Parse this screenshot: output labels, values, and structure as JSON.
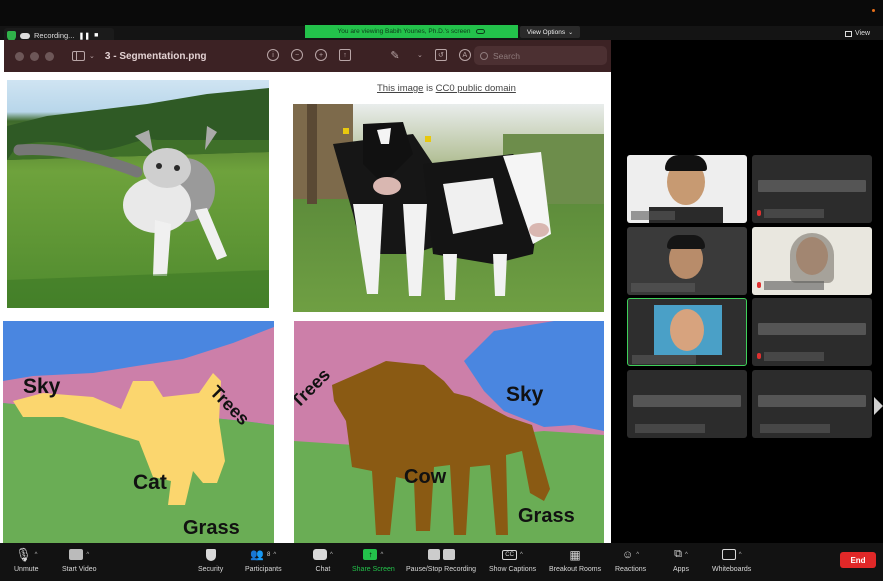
{
  "topbar": {
    "recording_label": "Recording...",
    "pause_icon": "pause-icon",
    "stop_icon": "stop-icon",
    "viewing_banner": "You are viewing Babih Younes, Ph.D.'s screen",
    "view_options": "View Options",
    "view_button": "View"
  },
  "preview_window": {
    "title": "3 - Segmentation.png",
    "search_placeholder": "Search",
    "toolbar_icons": [
      "info-icon",
      "zoom-out-icon",
      "zoom-in-icon",
      "share-icon",
      "markup-icon",
      "rotate-icon",
      "annotate-icon"
    ]
  },
  "document": {
    "credit_link": "This image",
    "credit_middle": "is",
    "credit_license": "CC0 public domain",
    "cat_labels": {
      "sky": "Sky",
      "trees": "Trees",
      "cat": "Cat",
      "grass": "Grass"
    },
    "cow_labels": {
      "trees": "Trees",
      "sky": "Sky",
      "cow": "Cow",
      "grass": "Grass"
    },
    "segment_colors": {
      "sky": "#4a86e0",
      "trees": "#cc7fa9",
      "grass": "#6aad55",
      "cat": "#fbd66e",
      "cow": "#8a5a13"
    }
  },
  "gallery": {
    "tile_count": 8,
    "active_tile_border": "#3fd05a"
  },
  "toolbar": {
    "unmute": "Unmute",
    "start_video": "Start Video",
    "security": "Security",
    "participants": "Participants",
    "participants_count": "8",
    "chat": "Chat",
    "share_screen": "Share Screen",
    "pause_stop_recording": "Pause/Stop Recording",
    "show_captions": "Show Captions",
    "captions_icon_text": "CC",
    "breakout_rooms": "Breakout Rooms",
    "reactions": "Reactions",
    "apps": "Apps",
    "whiteboards": "Whiteboards",
    "end": "End"
  }
}
